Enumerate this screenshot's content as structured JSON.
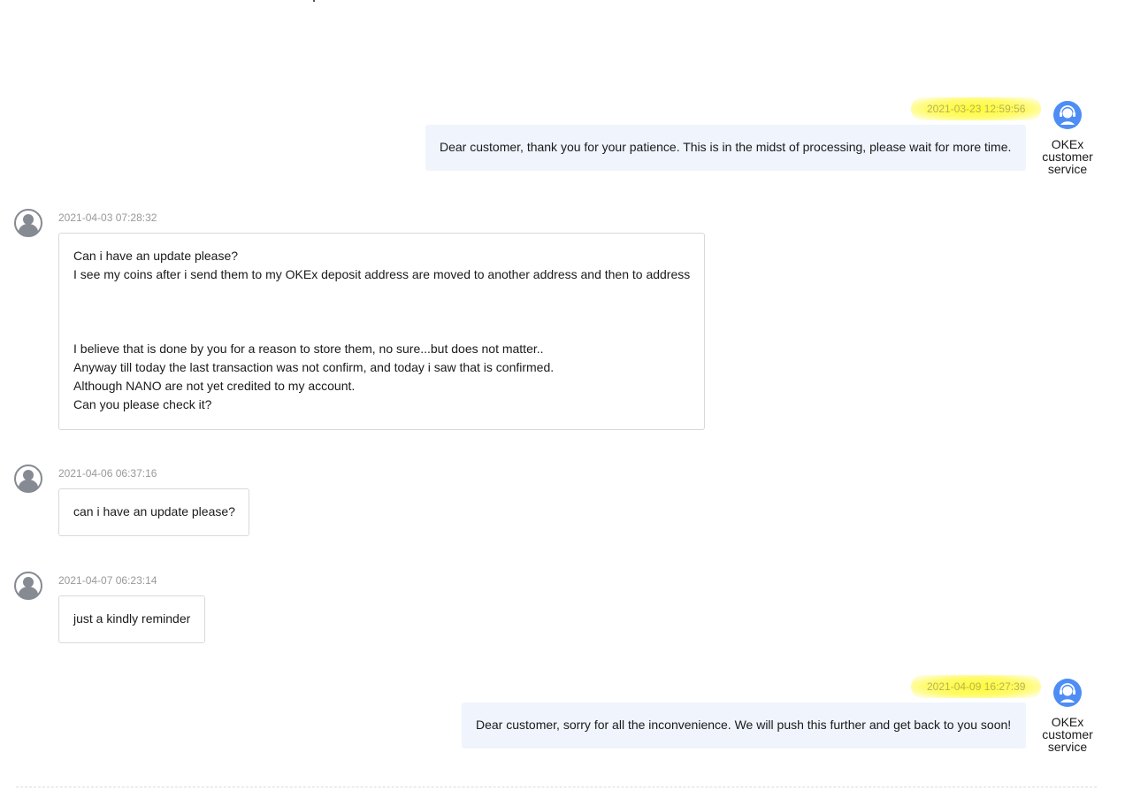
{
  "conversation": {
    "messages": [
      {
        "sender": "agent",
        "time": "2021-03-23 12:59:56",
        "agent_name": [
          "OKEx",
          "customer",
          "service"
        ],
        "text": "Dear customer, thank you for your patience. This is in the midst of processing, please wait for more time."
      },
      {
        "sender": "user",
        "time": "2021-04-03 07:28:32",
        "lines": [
          "Can i have an update please?",
          "I see my coins after i send them to my OKEx deposit address are moved to another address and then to address",
          "",
          "",
          "",
          "I believe that is done by you for a reason to store them, no sure...but does not matter..",
          "Anyway till today the last transaction was not confirm, and today i saw that is confirmed.",
          "Although NANO are not yet credited to my account.",
          "Can you please check it?"
        ]
      },
      {
        "sender": "user",
        "time": "2021-04-06 06:37:16",
        "lines": [
          "can i have an update please?"
        ]
      },
      {
        "sender": "user",
        "time": "2021-04-07 06:23:14",
        "lines": [
          "just a kindly reminder"
        ]
      },
      {
        "sender": "agent",
        "time": "2021-04-09 16:27:39",
        "agent_name": [
          "OKEx",
          "customer",
          "service"
        ],
        "text": "Dear customer, sorry for all the inconvenience. We will push this further and get back to you soon!"
      }
    ]
  },
  "colors": {
    "agent_bubble": "#eff4fd",
    "agent_avatar": "#4e8df5",
    "user_avatar": "#858a93",
    "timestamp": "#999999",
    "highlight": "#fffa28"
  },
  "icons": {
    "agent_avatar": "headset-icon",
    "user_avatar": "user-icon"
  }
}
